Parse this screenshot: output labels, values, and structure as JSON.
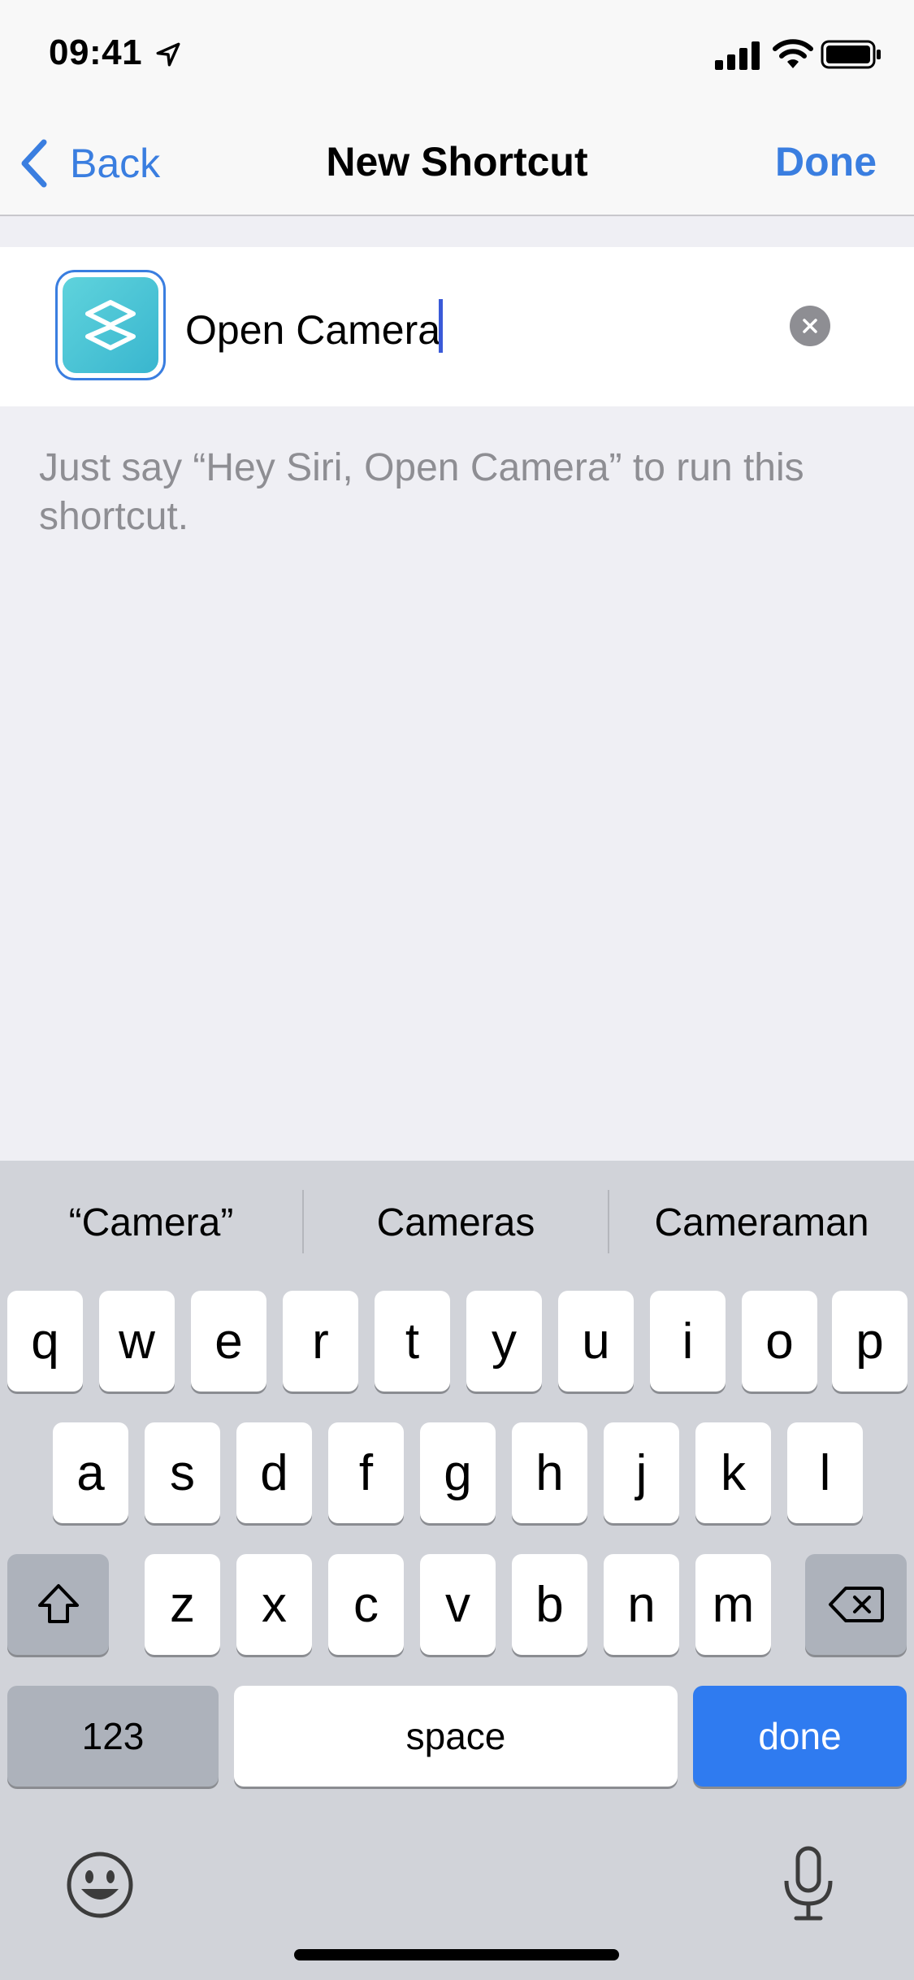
{
  "status_bar": {
    "time": "09:41"
  },
  "nav": {
    "back_label": "Back",
    "title": "New Shortcut",
    "done_label": "Done"
  },
  "shortcut": {
    "name_value": "Open Camera",
    "hint": "Just say “Hey Siri, Open Camera” to run this shortcut."
  },
  "keyboard": {
    "suggestions": [
      "“Camera”",
      "Cameras",
      "Cameraman"
    ],
    "row1": [
      "q",
      "w",
      "e",
      "r",
      "t",
      "y",
      "u",
      "i",
      "o",
      "p"
    ],
    "row2": [
      "a",
      "s",
      "d",
      "f",
      "g",
      "h",
      "j",
      "k",
      "l"
    ],
    "row3": [
      "z",
      "x",
      "c",
      "v",
      "b",
      "n",
      "m"
    ],
    "numbers_label": "123",
    "space_label": "space",
    "done_label": "done"
  },
  "colors": {
    "accent": "#3a7ee0",
    "done_key": "#2f7bf0",
    "icon_teal": "#4cc6d6"
  }
}
